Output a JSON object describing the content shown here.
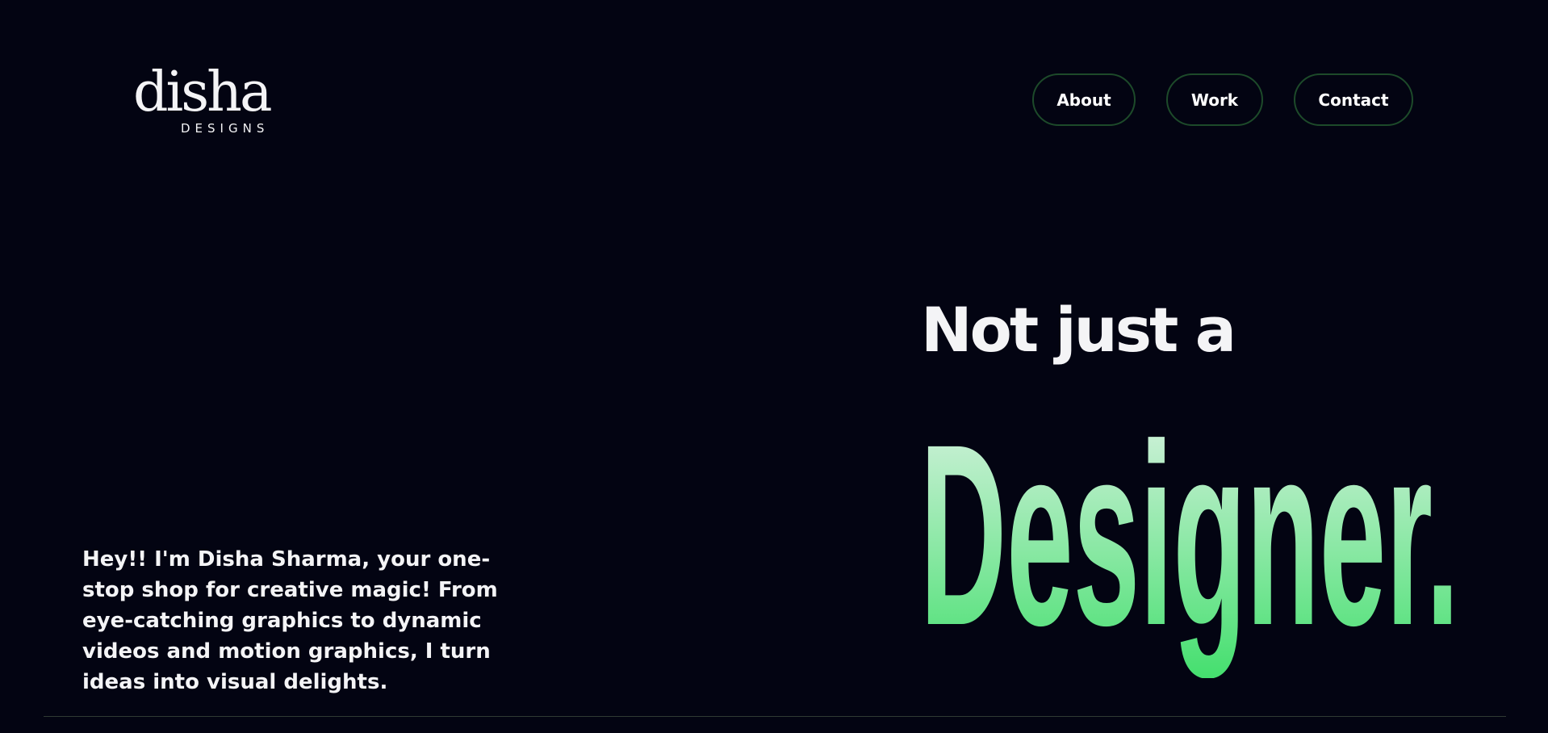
{
  "logo": {
    "script": "disha",
    "subtitle": "DESIGNS"
  },
  "nav": {
    "about": "About",
    "work": "Work",
    "contact": "Contact"
  },
  "hero": {
    "lead": "Not just a",
    "big": "Designer."
  },
  "intro": {
    "text": "Hey!! I'm Disha Sharma, your one-stop shop for creative magic! From eye-catching graphics to dynamic videos and motion graphics, I turn ideas into visual delights."
  },
  "colors": {
    "background": "#030412",
    "text": "#f4f4f6",
    "nav_border": "#1d4a2a",
    "gradient_top": "#dff3e6",
    "gradient_bottom": "#44df6e"
  }
}
